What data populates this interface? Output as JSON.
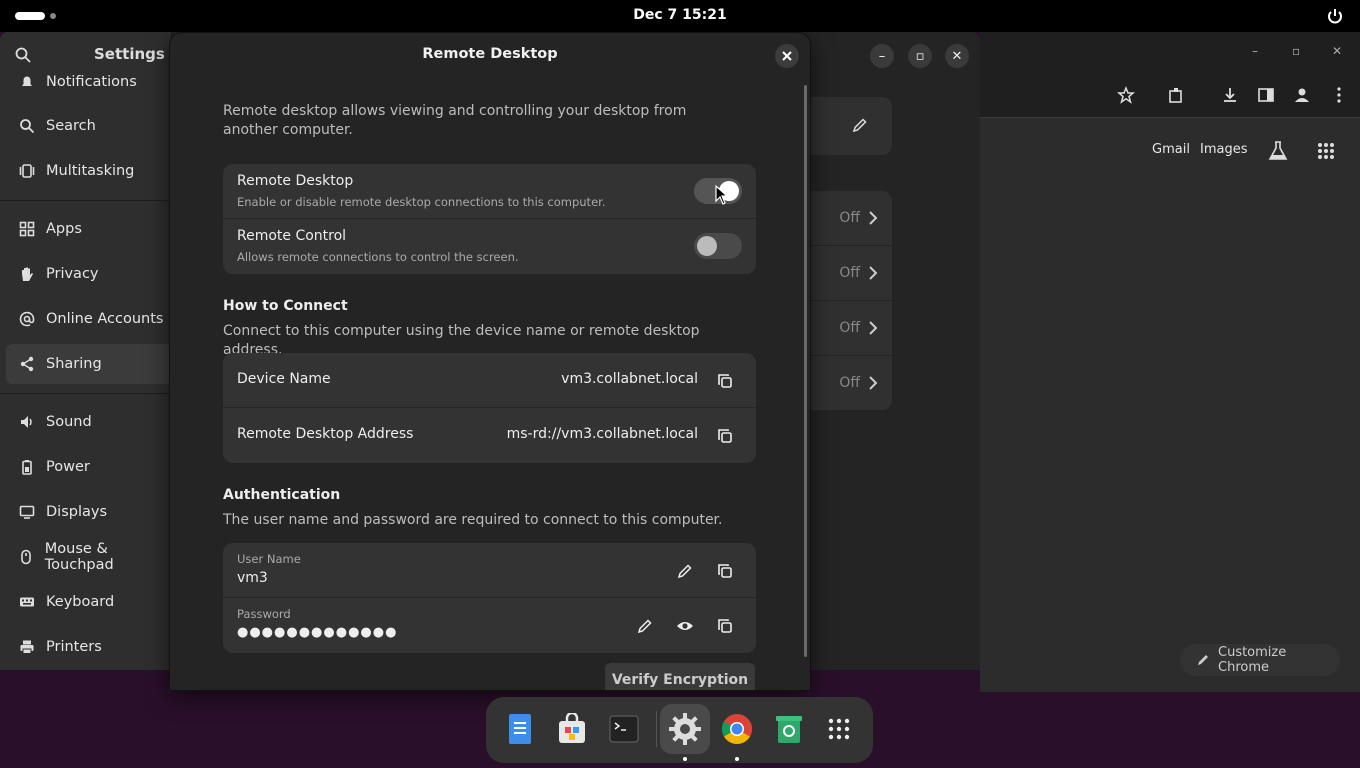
{
  "topbar": {
    "clock": "Dec 7  15:21"
  },
  "settings": {
    "title": "Settings",
    "sidebar": [
      {
        "label": "Notifications",
        "icon": "bell-icon"
      },
      {
        "label": "Search",
        "icon": "search-icon"
      },
      {
        "label": "Multitasking",
        "icon": "multitasking-icon"
      },
      {
        "label": "Apps",
        "icon": "apps-grid-icon"
      },
      {
        "label": "Privacy",
        "icon": "hand-icon"
      },
      {
        "label": "Online Accounts",
        "icon": "at-icon"
      },
      {
        "label": "Sharing",
        "icon": "share-icon",
        "active": true
      },
      {
        "label": "Sound",
        "icon": "speaker-icon"
      },
      {
        "label": "Power",
        "icon": "power-icon"
      },
      {
        "label": "Displays",
        "icon": "display-icon"
      },
      {
        "label": "Mouse & Touchpad",
        "icon": "mouse-icon"
      },
      {
        "label": "Keyboard",
        "icon": "keyboard-icon"
      },
      {
        "label": "Printers",
        "icon": "printer-icon"
      }
    ],
    "ghost_rows": [
      "Off",
      "Off",
      "Off",
      "Off"
    ]
  },
  "dialog": {
    "title": "Remote Desktop",
    "intro": "Remote desktop allows viewing and controlling your desktop from another computer.",
    "toggles": [
      {
        "title": "Remote Desktop",
        "subtitle": "Enable or disable remote desktop connections to this computer.",
        "on": true
      },
      {
        "title": "Remote Control",
        "subtitle": "Allows remote connections to control the screen.",
        "on": false
      }
    ],
    "connect": {
      "heading": "How to Connect",
      "description": "Connect to this computer using the device name or remote desktop address.",
      "device_name_label": "Device Name",
      "device_name_value": "vm3.collabnet.local",
      "address_label": "Remote Desktop Address",
      "address_value": "ms-rd://vm3.collabnet.local"
    },
    "auth": {
      "heading": "Authentication",
      "description": "The user name and password are required to connect to this computer.",
      "username_label": "User Name",
      "username_value": "vm3",
      "password_label": "Password",
      "password_value": "●●●●●●●●●●●●●"
    },
    "verify_button": "Verify Encryption"
  },
  "chrome": {
    "links": [
      "Gmail",
      "Images"
    ],
    "customize": "Customize Chrome"
  },
  "dock": {
    "apps": [
      "files-icon",
      "software-icon",
      "terminal-icon",
      "settings-icon",
      "chrome-icon",
      "trash-icon",
      "app-grid-icon"
    ]
  },
  "colors": {
    "accent": "#ffffff",
    "panel": "#333333",
    "background": "#242424"
  }
}
